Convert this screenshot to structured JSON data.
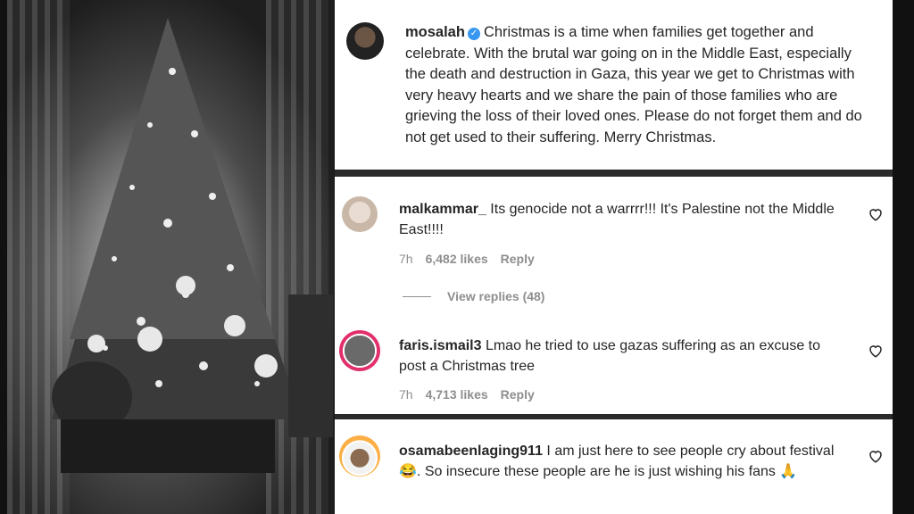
{
  "post": {
    "username": "mosalah",
    "caption": "Christmas is a time when families get together and celebrate. With the brutal war going on in the Middle East, especially the death and destruction in Gaza, this year we get to Christmas with very heavy hearts and we share the pain of those families who are grieving the loss of their loved ones. Please do not forget them and do not get used to their suffering. Merry Christmas."
  },
  "comments": [
    {
      "username": "malkammar_",
      "text": "Its genocide not a warrrr!!! It's Palestine not the Middle East!!!!",
      "time": "7h",
      "likes": "6,482 likes",
      "reply": "Reply",
      "view_replies": "View replies (48)"
    },
    {
      "username": "faris.ismail3",
      "text": "Lmao he tried to use gazas suffering as an excuse to post a Christmas tree",
      "time": "7h",
      "likes": "4,713 likes",
      "reply": "Reply"
    },
    {
      "username": "osamabeenlaging911",
      "text": "I am just here to see people cry about festival 😂. So insecure these people are he is just wishing his fans 🙏"
    }
  ],
  "icons": {
    "heart": "heart-outline-icon",
    "verified": "verified-badge-icon"
  }
}
